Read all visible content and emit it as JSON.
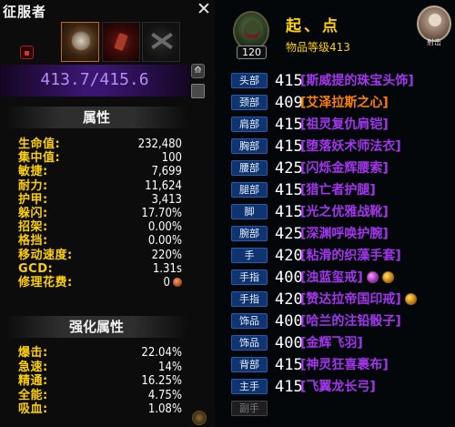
{
  "left": {
    "title": "征服者",
    "close_label": "✕",
    "ilvl_text": "413.7/415.6",
    "attr_header": "属性",
    "stats": [
      {
        "name": "生命值:",
        "value": "232,480"
      },
      {
        "name": "集中值:",
        "value": "100"
      },
      {
        "name": "敏捷:",
        "value": "7,699"
      },
      {
        "name": "耐力:",
        "value": "11,624"
      },
      {
        "name": "护甲:",
        "value": "3,413"
      },
      {
        "name": "躲闪:",
        "value": "17.70%"
      },
      {
        "name": "招架:",
        "value": "0.00%"
      },
      {
        "name": "格挡:",
        "value": "0.00%"
      },
      {
        "name": "移动速度:",
        "value": "220%"
      },
      {
        "name": "GCD:",
        "value": "1.31s"
      },
      {
        "name": "修理花费:",
        "value": "0"
      }
    ],
    "enh_header": "强化属性",
    "enh_stats": [
      {
        "name": "爆击:",
        "value": "22.04%"
      },
      {
        "name": "急速:",
        "value": "14%"
      },
      {
        "name": "精通:",
        "value": "16.25%"
      },
      {
        "name": "全能:",
        "value": "4.75%"
      },
      {
        "name": "吸血:",
        "value": "1.08%"
      }
    ]
  },
  "right": {
    "character_name": "起、点",
    "level": "120",
    "item_level_label": "物品等级413",
    "target_label": "射击",
    "slots": [
      {
        "slot": "头部",
        "level": "415",
        "name": "[斯威提的珠宝头饰]",
        "color": "#a335ee",
        "gems": []
      },
      {
        "slot": "颈部",
        "level": "409",
        "name": "[艾泽拉斯之心]",
        "color": "#ff8000",
        "gems": []
      },
      {
        "slot": "肩部",
        "level": "415",
        "name": "[祖灵复仇肩铠]",
        "color": "#a335ee",
        "gems": []
      },
      {
        "slot": "胸部",
        "level": "415",
        "name": "[堕落妖术师法衣]",
        "color": "#a335ee",
        "gems": []
      },
      {
        "slot": "腰部",
        "level": "425",
        "name": "[闪烁金辉腰索]",
        "color": "#a335ee",
        "gems": []
      },
      {
        "slot": "腿部",
        "level": "415",
        "name": "[猎亡者护腿]",
        "color": "#a335ee",
        "gems": []
      },
      {
        "slot": "脚",
        "level": "415",
        "name": "[光之优雅战靴]",
        "color": "#a335ee",
        "gems": []
      },
      {
        "slot": "腕部",
        "level": "425",
        "name": "[深渊呼唤护腕]",
        "color": "#a335ee",
        "gems": []
      },
      {
        "slot": "手",
        "level": "420",
        "name": "[粘滑的织藻手套]",
        "color": "#a335ee",
        "gems": []
      },
      {
        "slot": "手指",
        "level": "400",
        "name": "[浊蓝玺戒]",
        "color": "#a335ee",
        "gems": [
          "purple",
          "orange"
        ]
      },
      {
        "slot": "手指",
        "level": "420",
        "name": "[赞达拉帝国印戒]",
        "color": "#a335ee",
        "gems": [
          "orange"
        ]
      },
      {
        "slot": "饰品",
        "level": "400",
        "name": "[哈兰的注铅骰子]",
        "color": "#a335ee",
        "gems": []
      },
      {
        "slot": "饰品",
        "level": "400",
        "name": "[金辉飞羽]",
        "color": "#a335ee",
        "gems": []
      },
      {
        "slot": "背部",
        "level": "415",
        "name": "[神灵狂喜裹布]",
        "color": "#a335ee",
        "gems": []
      },
      {
        "slot": "主手",
        "level": "415",
        "name": "[飞翼龙长弓]",
        "color": "#a335ee",
        "gems": []
      },
      {
        "slot": "副手",
        "level": "",
        "name": "",
        "color": "#777777",
        "gems": [],
        "empty": true
      }
    ]
  }
}
